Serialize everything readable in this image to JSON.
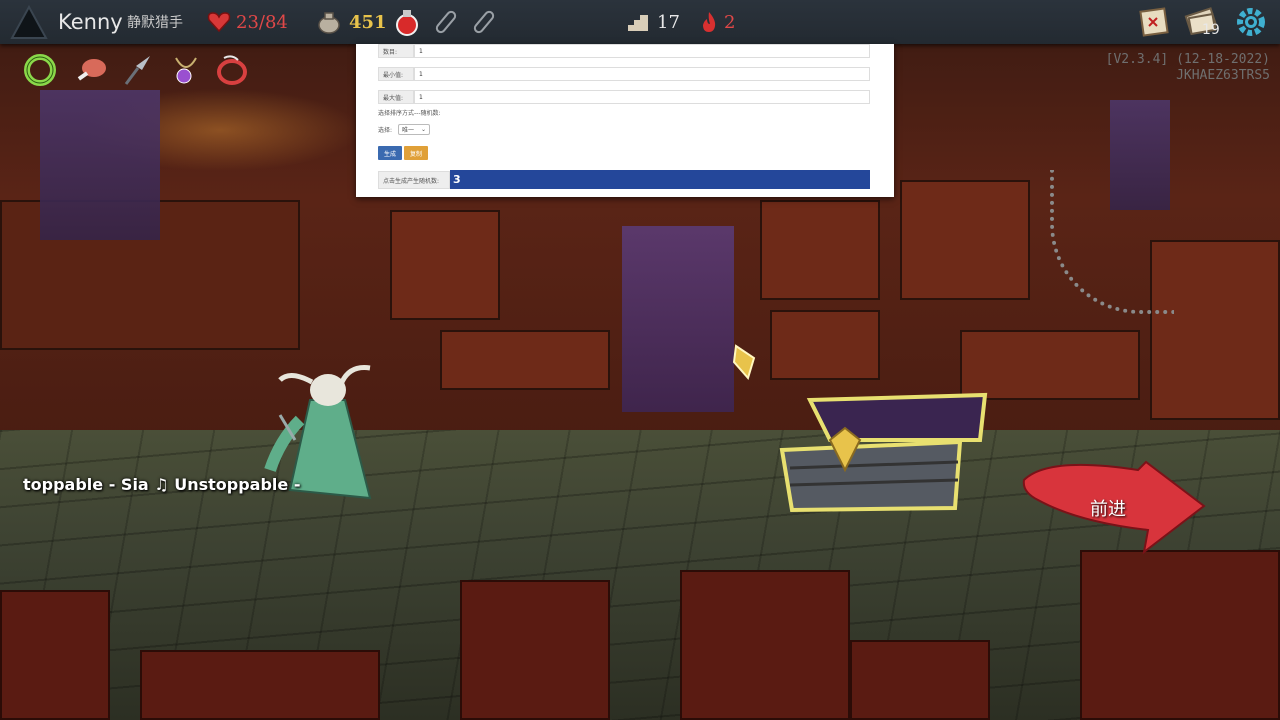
{
  "topbar": {
    "player_name": "Kenny",
    "player_class": "静默猎手",
    "hp": "23/84",
    "gold": "451",
    "floor": "17",
    "ascension": "2",
    "deck_count": "19"
  },
  "version": {
    "line1": "[V2.3.4] (12-18-2022)",
    "line2": "JKHAEZ63TRS5"
  },
  "form": {
    "count_label": "数目:",
    "count_value": "1",
    "min_label": "最小值:",
    "min_value": "1",
    "max_label": "最大值:",
    "max_value": "1",
    "hint": "选择排序方式---随机数:",
    "select_label": "选择:",
    "select_value": "唯一",
    "generate_button": "生成",
    "copy_button": "复制",
    "result_label": "点击生成产生随机数:",
    "result_value": "3"
  },
  "lyrics": {
    "text": "toppable - Sia   ♫ Unstoppable -"
  },
  "proceed": {
    "label": "前进"
  },
  "colors": {
    "hp": "#e04848",
    "gold": "#e8c34b",
    "result_bg": "#24479a",
    "proceed_arrow": "#d8343c"
  }
}
